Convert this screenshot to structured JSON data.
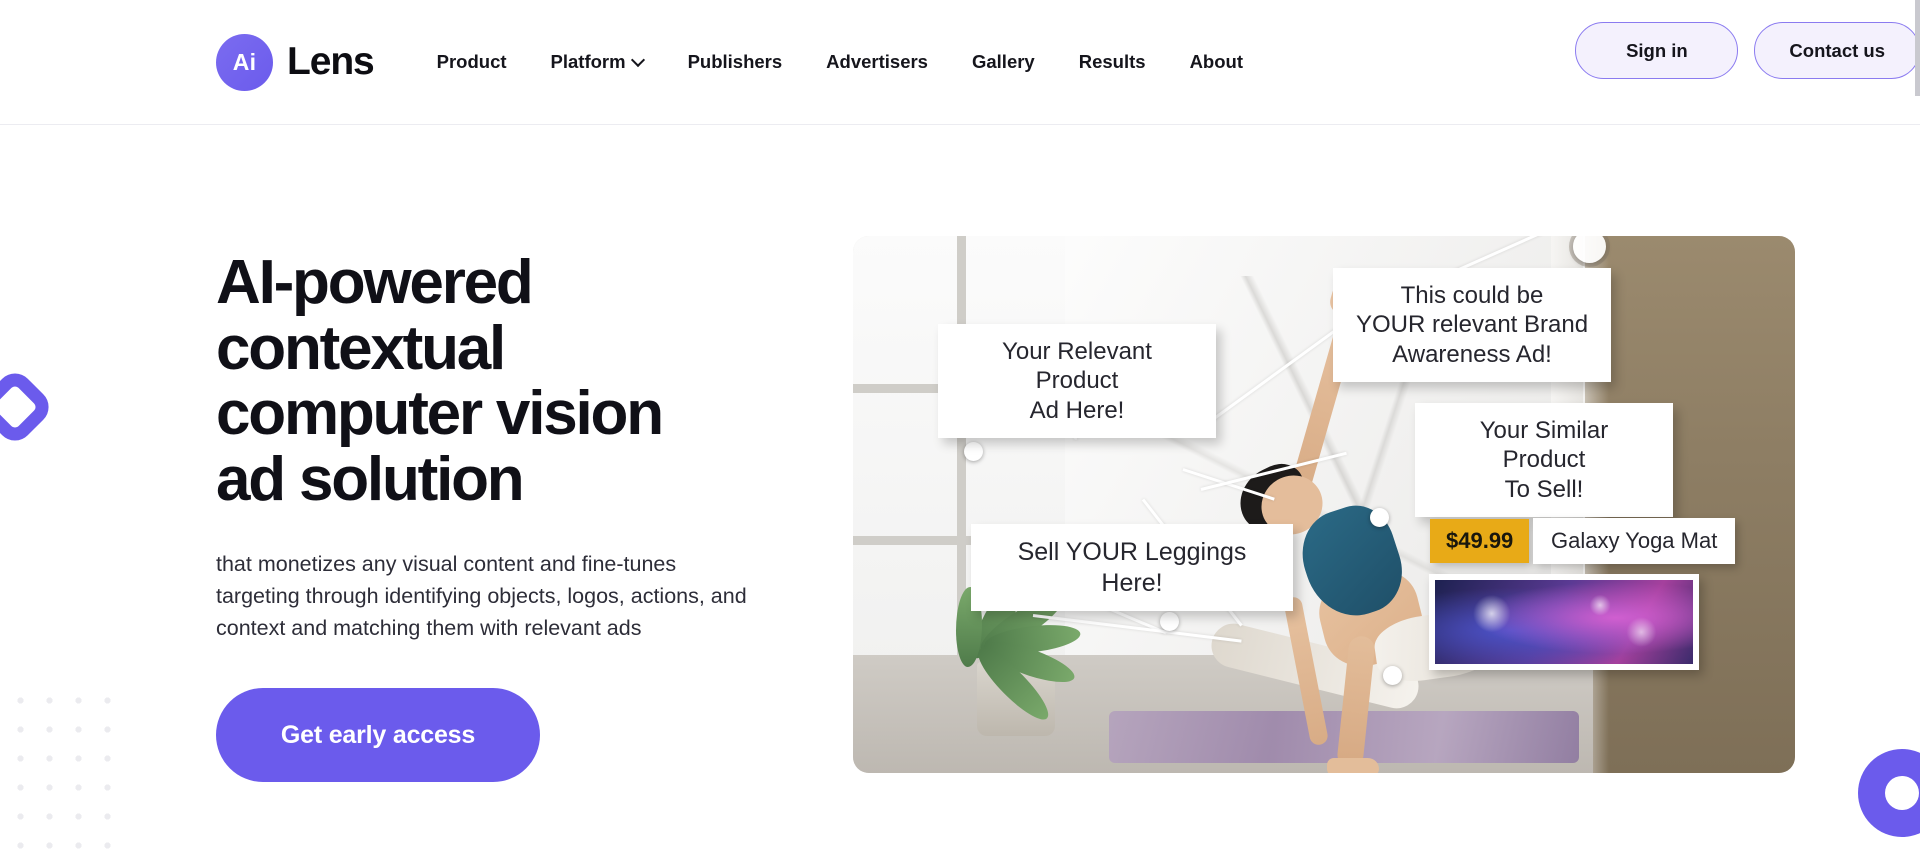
{
  "header": {
    "brand": {
      "logo_text": "Ai",
      "name": "Lens"
    },
    "nav": [
      {
        "label": "Product",
        "has_chevron": false
      },
      {
        "label": "Platform",
        "has_chevron": true
      },
      {
        "label": "Publishers",
        "has_chevron": false
      },
      {
        "label": "Advertisers",
        "has_chevron": false
      },
      {
        "label": "Gallery",
        "has_chevron": false
      },
      {
        "label": "Results",
        "has_chevron": false
      },
      {
        "label": "About",
        "has_chevron": false
      }
    ],
    "sign_in_label": "Sign in",
    "contact_label": "Contact us"
  },
  "hero": {
    "headline": "AI-powered contextual computer vision ad solution",
    "subtext": "that monetizes any visual content and fine-tunes targeting through identifying objects, logos, actions, and context and matching them with relevant ads",
    "cta_label": "Get early access"
  },
  "hero_image": {
    "alt": "Yoga studio photo with contextual ad annotations",
    "annotations": [
      {
        "id": "relevant-product",
        "text": "Your Relevant Product\nAd Here!"
      },
      {
        "id": "brand-awareness",
        "text": "This could be\nYOUR relevant Brand\nAwareness Ad!"
      },
      {
        "id": "similar-product",
        "text": "Your Similar Product\nTo Sell!"
      },
      {
        "id": "leggings",
        "text": "Sell YOUR Leggings Here!"
      }
    ],
    "product_card": {
      "price": "$49.99",
      "title": "Galaxy Yoga Mat"
    }
  },
  "chat": {
    "icon": "chat-bubble-icon"
  },
  "colors": {
    "brand_purple": "#6b5bec",
    "outline_button_bg": "#f4f1fd",
    "outline_button_border": "#8b7bf0",
    "price_badge": "#e8aa17",
    "text_dark": "#101017",
    "dots_grey": "#ebebef"
  }
}
